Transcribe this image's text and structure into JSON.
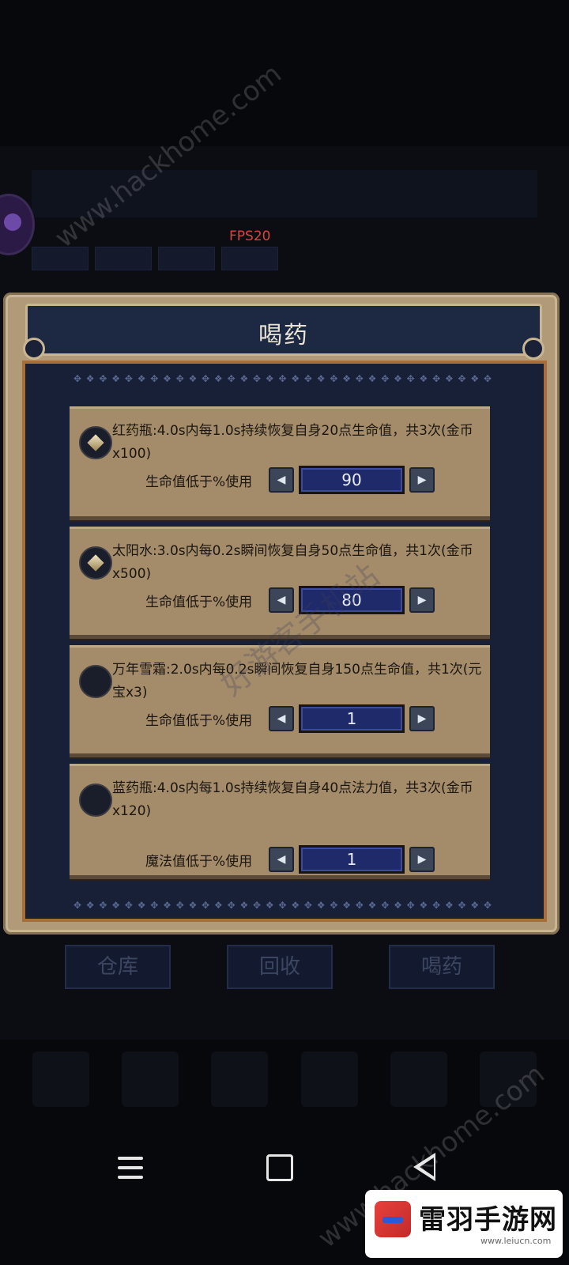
{
  "hud": {
    "fps": "FPS20"
  },
  "dialog": {
    "title": "喝药",
    "items": [
      {
        "icon": "diamond-gem-icon",
        "desc": "红药瓶:4.0s内每1.0s持续恢复自身20点生命值，共3次(金币x100)",
        "label": "生命值低于%使用",
        "value": "90"
      },
      {
        "icon": "diamond-gem-icon",
        "desc": "太阳水:3.0s内每0.2s瞬间恢复自身50点生命值，共1次(金币x500)",
        "label": "生命值低于%使用",
        "value": "80"
      },
      {
        "icon": "empty-gem-icon",
        "desc": "万年雪霜:2.0s内每0.2s瞬间恢复自身150点生命值，共1次(元宝x3)",
        "label": "生命值低于%使用",
        "value": "1"
      },
      {
        "icon": "empty-gem-icon",
        "desc": "蓝药瓶:4.0s内每1.0s持续恢复自身40点法力值，共3次(金币x120)",
        "label": "魔法值低于%使用",
        "value": "1"
      }
    ]
  },
  "bottom_buttons": {
    "warehouse": "仓库",
    "recycle": "回收",
    "potion": "喝药"
  },
  "watermarks": {
    "site": "www.hackhome.com",
    "cn": "好游客手机站"
  },
  "brand": {
    "name": "雷羽手游网",
    "url": "www.leiucn.com"
  }
}
